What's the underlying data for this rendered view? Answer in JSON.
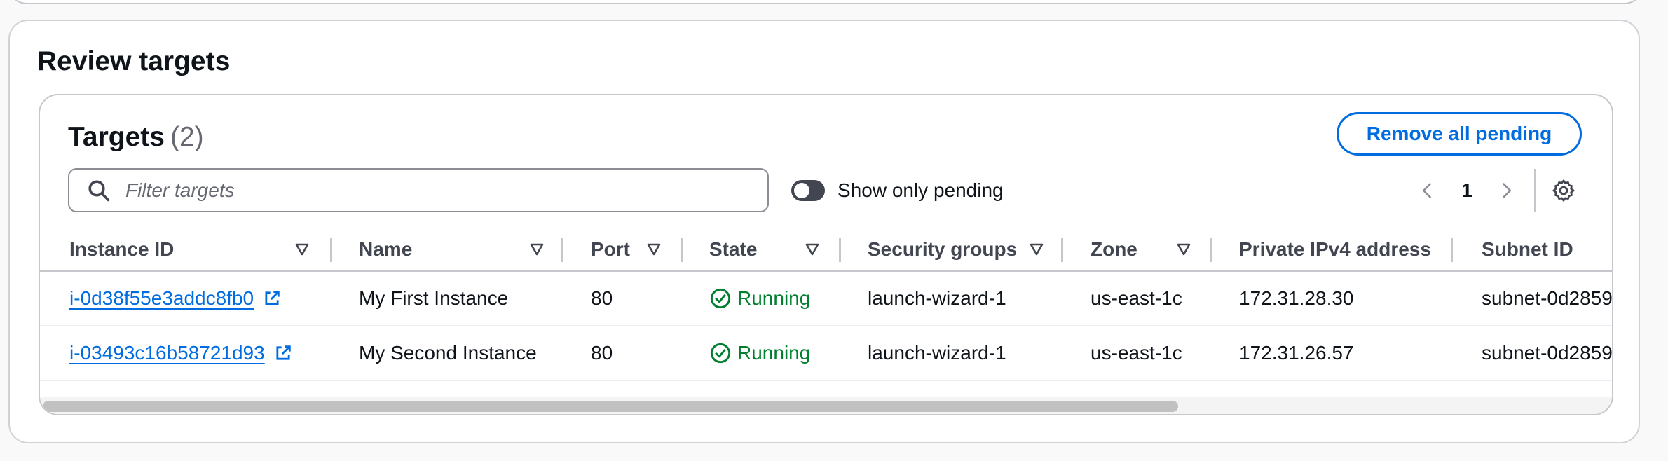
{
  "section": {
    "title": "Review targets"
  },
  "targets": {
    "title": "Targets",
    "count": "(2)",
    "remove_all_label": "Remove all pending",
    "filter_placeholder": "Filter targets",
    "show_only_pending_label": "Show only pending",
    "show_only_pending_on": false,
    "current_page": "1"
  },
  "columns": {
    "instance_id": "Instance ID",
    "name": "Name",
    "port": "Port",
    "state": "State",
    "security_groups": "Security groups",
    "zone": "Zone",
    "private_ipv4": "Private IPv4 address",
    "subnet_id": "Subnet ID"
  },
  "rows": [
    {
      "instance_id": "i-0d38f55e3addc8fb0",
      "name": "My First Instance",
      "port": "80",
      "state": "Running",
      "security_groups": "launch-wizard-1",
      "zone": "us-east-1c",
      "private_ipv4": "172.31.28.30",
      "subnet_id": "subnet-0d2859"
    },
    {
      "instance_id": "i-03493c16b58721d93",
      "name": "My Second Instance",
      "port": "80",
      "state": "Running",
      "security_groups": "launch-wizard-1",
      "zone": "us-east-1c",
      "private_ipv4": "172.31.26.57",
      "subnet_id": "subnet-0d2859"
    }
  ],
  "icons": {
    "search": "search-icon",
    "sort": "sort-down-triangle-icon",
    "external_link": "external-link-icon",
    "status_ok": "check-circle-icon",
    "pager_prev": "chevron-left-icon",
    "pager_next": "chevron-right-icon",
    "settings": "gear-icon"
  },
  "colors": {
    "link": "#006ce0",
    "success": "#00802f",
    "border": "#c6c6cd"
  }
}
